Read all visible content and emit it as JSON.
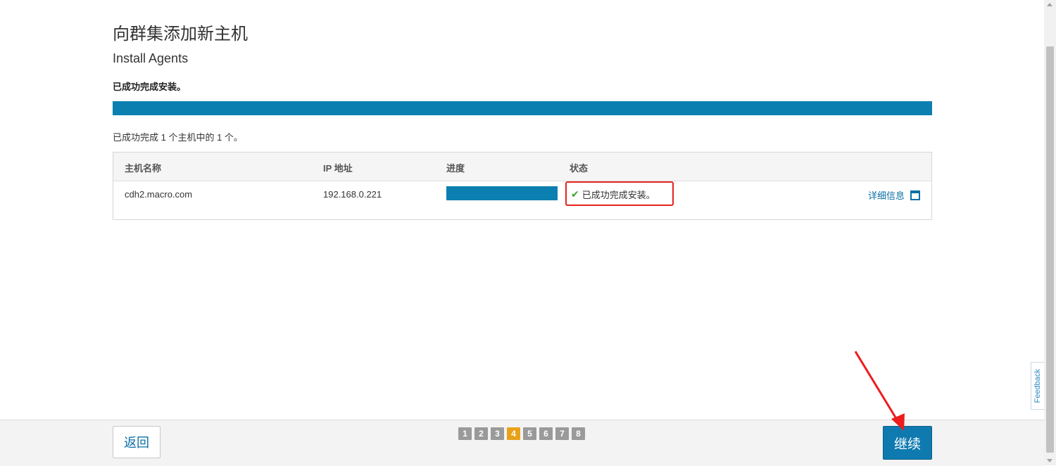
{
  "page": {
    "title": "向群集添加新主机",
    "subtitle": "Install Agents",
    "status_message": "已成功完成安装。",
    "overall_progress": 1.0,
    "summary": "已成功完成 1 个主机中的 1 个。"
  },
  "table": {
    "columns": [
      "主机名称",
      "IP 地址",
      "进度",
      "状态"
    ],
    "rows": [
      {
        "hostname": "cdh2.macro.com",
        "ip": "192.168.0.221",
        "progress": 1.0,
        "status": "已成功完成安装。",
        "details_label": "详细信息"
      }
    ]
  },
  "footer": {
    "back_label": "返回",
    "continue_label": "继续",
    "steps": [
      "1",
      "2",
      "3",
      "4",
      "5",
      "6",
      "7",
      "8"
    ],
    "active_step": "4"
  },
  "feedback_label": "Feedback",
  "icons": {
    "status": "check-icon",
    "details": "window-icon"
  },
  "colors": {
    "accent": "#0b7fb0",
    "active_step": "#e8a21a",
    "success": "#3aa335",
    "annotation": "#e5231f"
  }
}
